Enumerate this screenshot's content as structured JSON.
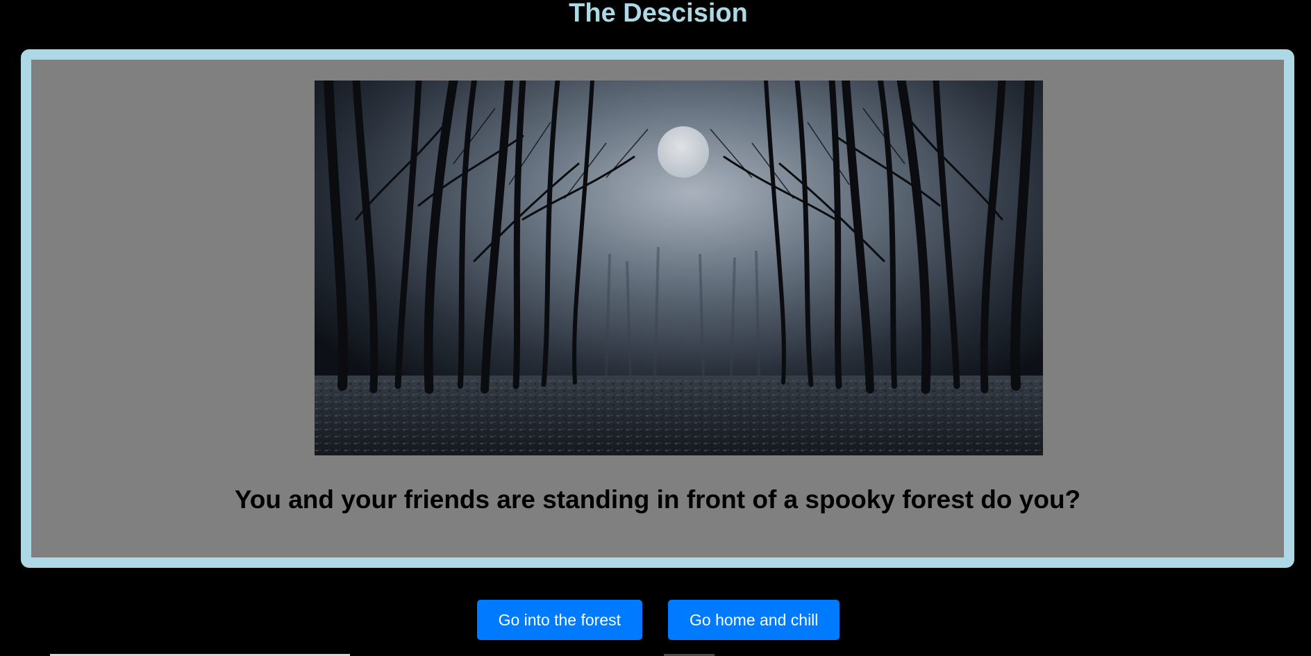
{
  "page": {
    "title": "The Descision"
  },
  "scene": {
    "image_name": "spooky-forest-moon",
    "question": "You and your friends are standing in front of a spooky forest do you?"
  },
  "choices": [
    {
      "label": "Go into the forest"
    },
    {
      "label": "Go home and chill"
    }
  ],
  "colors": {
    "background": "#000000",
    "title": "#add8e6",
    "frame_border": "#add8e6",
    "frame_fill": "#808080",
    "button": "#007bff",
    "button_text": "#ffffff"
  }
}
